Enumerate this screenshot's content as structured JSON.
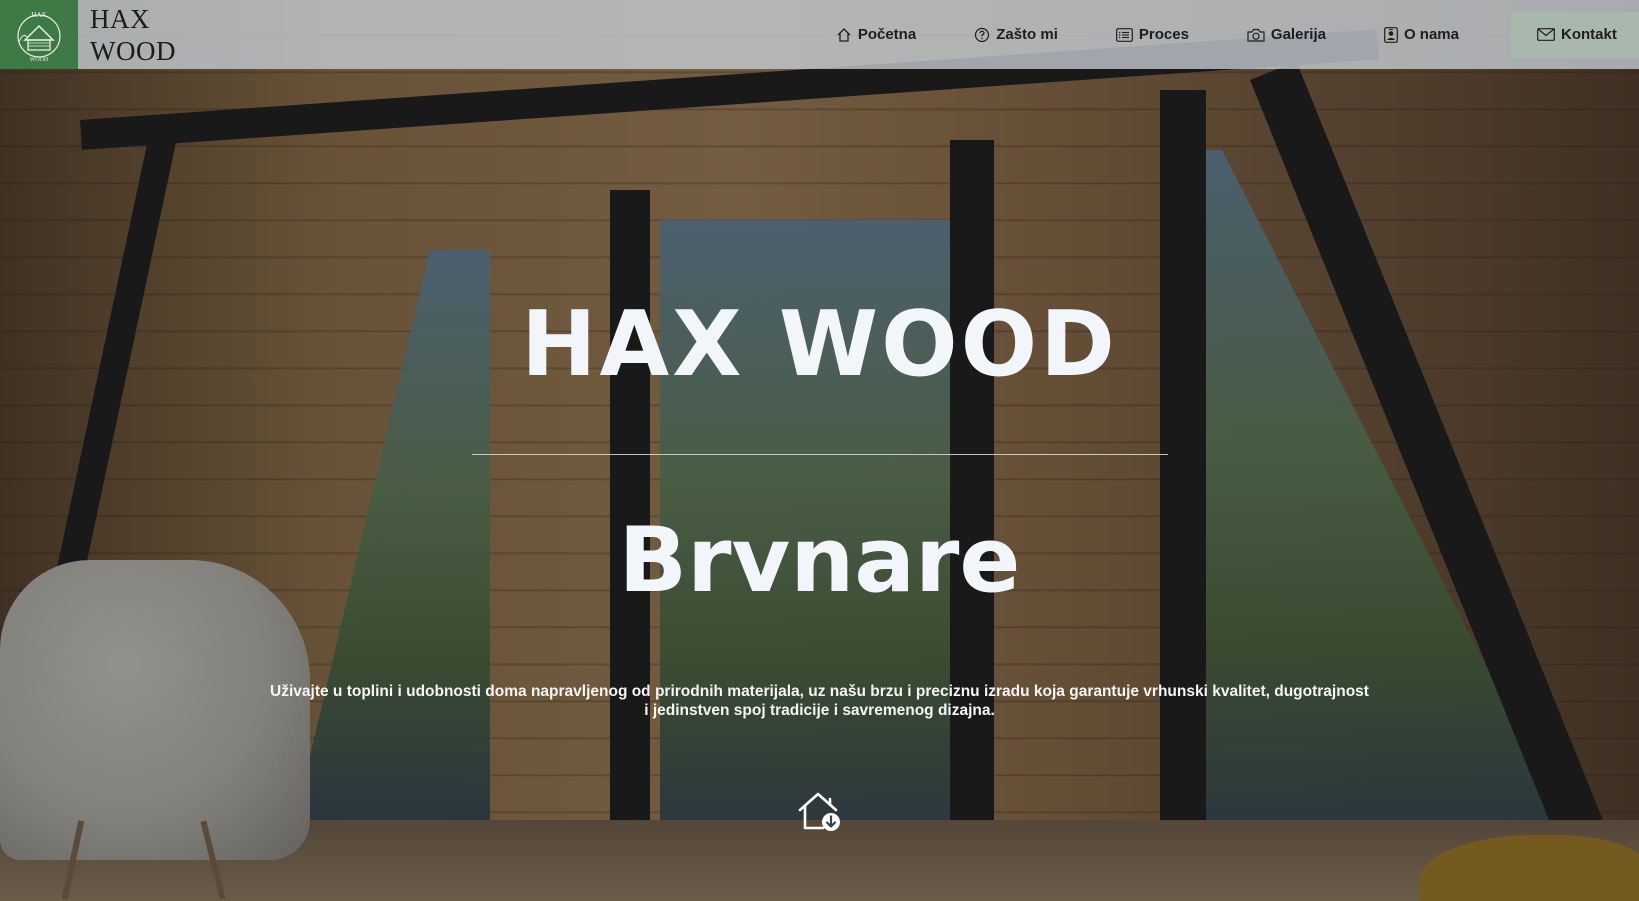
{
  "brand": {
    "logo_text_top": "HAX",
    "logo_text_bottom": "WOOD",
    "name_line1": "HAX",
    "name_line2": "WOOD",
    "logo_color": "#3d7a45"
  },
  "nav": {
    "items": [
      {
        "label": "Početna",
        "icon": "home-icon"
      },
      {
        "label": "Zašto mi",
        "icon": "question-circle-icon"
      },
      {
        "label": "Proces",
        "icon": "card-list-icon"
      },
      {
        "label": "Galerija",
        "icon": "camera-icon"
      },
      {
        "label": "O nama",
        "icon": "person-badge-icon"
      },
      {
        "label": "Kontakt",
        "icon": "envelope-icon"
      }
    ]
  },
  "hero": {
    "title": "HAX WOOD",
    "subtitle": "Brvnare",
    "description": "Uživajte u toplini i udobnosti doma napravljenog od prirodnih materijala, uz našu brzu i preciznu izradu koja garantuje vrhunski kvalitet, dugotrajnost i jedinstven spoj tradicije i savremenog dizajna.",
    "scroll_icon": "house-down-icon"
  }
}
